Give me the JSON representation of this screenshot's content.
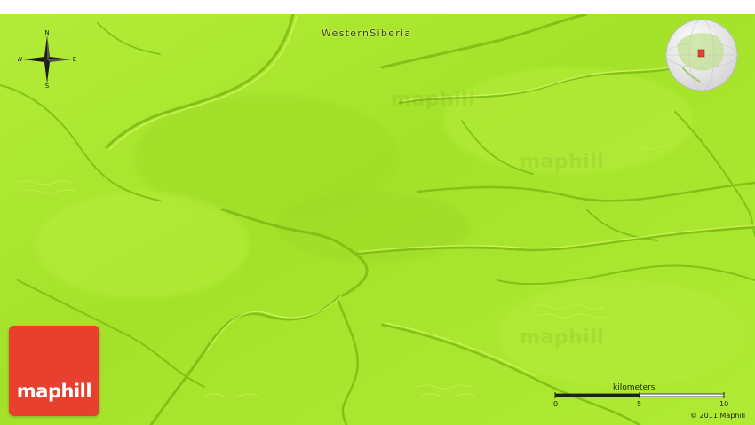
{
  "map": {
    "region_label": "WesternSiberia",
    "compass": {
      "north": "N",
      "south": "S",
      "east": "E",
      "west": "W"
    },
    "scale_bar": {
      "title": "kilometers",
      "ticks": [
        "0",
        "5",
        "10"
      ]
    },
    "watermark": "maphill",
    "logo_text": "maphill",
    "copyright": "© 2011 Maphill",
    "colors": {
      "terrain": "#a6e62c",
      "terrain_light": "#c3f24a",
      "terrain_shadow": "#7fbf16",
      "logo": "#e8402e"
    },
    "icons": [
      "compass-rose-icon",
      "locator-globe-icon"
    ]
  }
}
